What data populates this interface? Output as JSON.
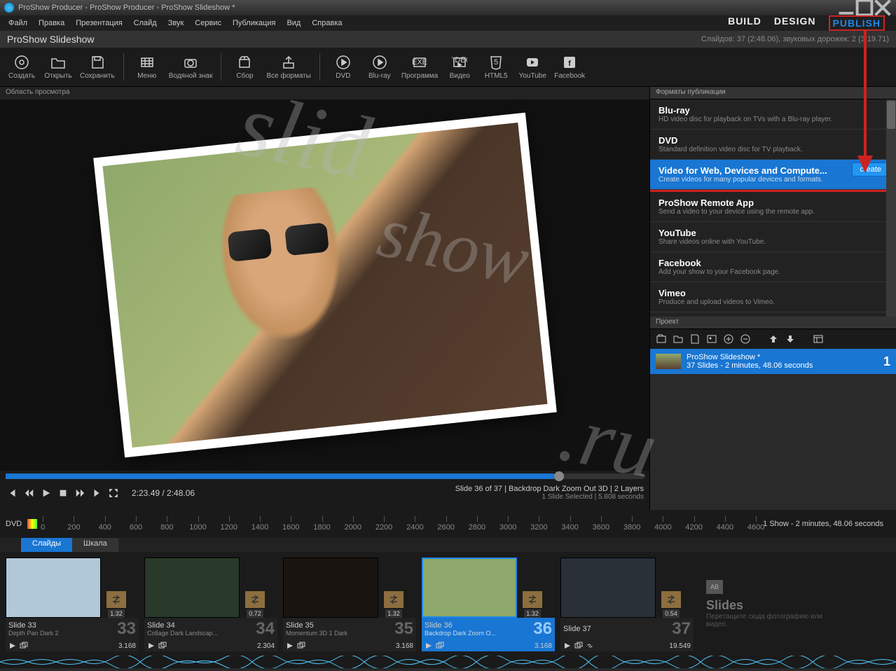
{
  "titlebar": {
    "text": "ProShow Producer - ProShow Producer - ProShow Slideshow *"
  },
  "menubar": {
    "items": [
      "Файл",
      "Правка",
      "Презентация",
      "Слайд",
      "Звук",
      "Сервис",
      "Публикация",
      "Вид",
      "Справка"
    ],
    "modes": {
      "build": "BUILD",
      "design": "DESIGN",
      "publish": "PUBLISH"
    }
  },
  "subheader": {
    "name": "ProShow Slideshow",
    "stats": "Слайдов: 37 (2:48.06), звуковых дорожек: 2 (3:19.71)"
  },
  "toolbar": [
    {
      "name": "create",
      "label": "Создать",
      "icon": "disc"
    },
    {
      "name": "open",
      "label": "Открыть",
      "icon": "folder"
    },
    {
      "name": "save",
      "label": "Сохранить",
      "icon": "save"
    },
    {
      "sep": true
    },
    {
      "name": "menu",
      "label": "Меню",
      "icon": "grid"
    },
    {
      "name": "watermark",
      "label": "Водяной знак",
      "icon": "camera"
    },
    {
      "sep": true
    },
    {
      "name": "collect",
      "label": "Сбор",
      "icon": "box"
    },
    {
      "name": "export",
      "label": "Все форматы",
      "icon": "up"
    },
    {
      "sep": true
    },
    {
      "name": "dvd",
      "label": "DVD",
      "icon": "discplay"
    },
    {
      "name": "bluray",
      "label": "Blu-ray",
      "icon": "discplay"
    },
    {
      "name": "exe",
      "label": "Программа",
      "icon": "exe"
    },
    {
      "name": "video",
      "label": "Видео",
      "icon": "video"
    },
    {
      "name": "html5",
      "label": "HTML5",
      "icon": "html5"
    },
    {
      "name": "youtube",
      "label": "YouTube",
      "icon": "youtube"
    },
    {
      "name": "facebook",
      "label": "Facebook",
      "icon": "facebook"
    }
  ],
  "preview": {
    "header": "Область просмотра"
  },
  "playback": {
    "time": "2:23.49 / 2:48.06",
    "slideinfo": "Slide 36 of 37  |  Backdrop Dark Zoom Out 3D  |  2 Layers",
    "sub": "1 Slide Selected  |  5.808 seconds"
  },
  "formats_header": "Форматы публикации",
  "formats": [
    {
      "title": "Blu-ray",
      "desc": "HD video disc for playback on TVs with a Blu-ray player."
    },
    {
      "title": "DVD",
      "desc": "Standard definition video disc for TV playback."
    },
    {
      "title": "Video for Web, Devices and Compute...",
      "desc": "Create videos for many popular devices and formats.",
      "selected": true,
      "create": "create"
    },
    {
      "title": "ProShow Remote App",
      "desc": "Send a video to your device using the remote app."
    },
    {
      "title": "YouTube",
      "desc": "Share videos online with YouTube."
    },
    {
      "title": "Facebook",
      "desc": "Add your show to your Facebook page."
    },
    {
      "title": "Vimeo",
      "desc": "Produce and upload videos to Vimeo."
    }
  ],
  "project": {
    "header": "Проект",
    "name": "ProShow Slideshow *",
    "details": "37 Slides - 2 minutes, 48.06 seconds",
    "num": "1"
  },
  "ruler": {
    "label": "DVD",
    "ticks": [
      0,
      200,
      400,
      600,
      800,
      1000,
      1200,
      1400,
      1600,
      1800,
      2000,
      2200,
      2400,
      2600,
      2800,
      3000,
      3200,
      3400,
      3600,
      3800,
      4000,
      4200,
      4400,
      4600
    ]
  },
  "show_summary": "1 Show - 2 minutes, 48.06 seconds",
  "tl_tabs": {
    "slides": "Слайды",
    "scale": "Шкала"
  },
  "slides": [
    {
      "n": "33",
      "name": "Slide 33",
      "style": "Depth Pan Dark 2",
      "dur": "3.168",
      "trans": "1.32",
      "thumb": "#b0c8d8"
    },
    {
      "n": "34",
      "name": "Slide 34",
      "style": "Collage Dark Landscap...",
      "dur": "2.304",
      "trans": "0.72",
      "thumb": "#2a3a2a"
    },
    {
      "n": "35",
      "name": "Slide 35",
      "style": "Momentum 3D 1 Dark",
      "dur": "3.168",
      "trans": "1.32",
      "thumb": "#1a1410"
    },
    {
      "n": "36",
      "name": "Slide 36",
      "style": "Backdrop Dark Zoom O...",
      "dur": "3.168",
      "trans": "1.32",
      "thumb": "#8fa86b",
      "selected": true
    },
    {
      "n": "37",
      "name": "Slide 37",
      "style": "",
      "dur": "19.549",
      "trans": "0.54",
      "thumb": "#2a3038"
    }
  ],
  "add_slide": {
    "title": "Slides",
    "desc": "Перетащите сюда фотографию или видео."
  },
  "watermark_text": "slidshow.ru"
}
